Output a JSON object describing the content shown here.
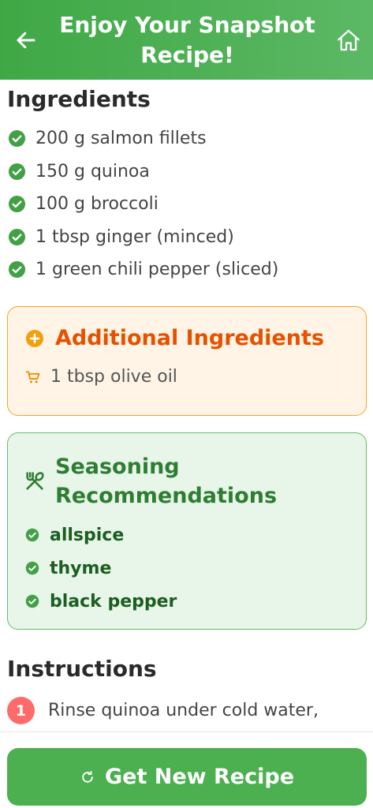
{
  "header": {
    "title": "Enjoy Your Snapshot Recipe!",
    "back_icon": "arrow-left-icon",
    "home_icon": "home-icon"
  },
  "ingredients": {
    "title": "Ingredients",
    "items": [
      "200 g salmon fillets",
      "150 g quinoa",
      "100 g broccoli",
      "1 tbsp ginger (minced)",
      "1 green chili pepper (sliced)"
    ]
  },
  "additional": {
    "title": "Additional Ingredients",
    "items": [
      "1 tbsp olive oil"
    ]
  },
  "seasoning": {
    "title": "Seasoning Recommendations",
    "items": [
      "allspice",
      "thyme",
      "black pepper"
    ]
  },
  "instructions": {
    "title": "Instructions",
    "steps": [
      {
        "number": "1",
        "text": "Rinse quinoa under cold water,"
      }
    ]
  },
  "footer": {
    "button_label": "Get New Recipe"
  },
  "colors": {
    "header_green": "#4caf50",
    "check_green": "#43a047",
    "orange_accent": "#e65100",
    "orange_border": "#f5a623",
    "seasoning_green": "#2e7d32",
    "step_badge": "#ff6b6b"
  }
}
